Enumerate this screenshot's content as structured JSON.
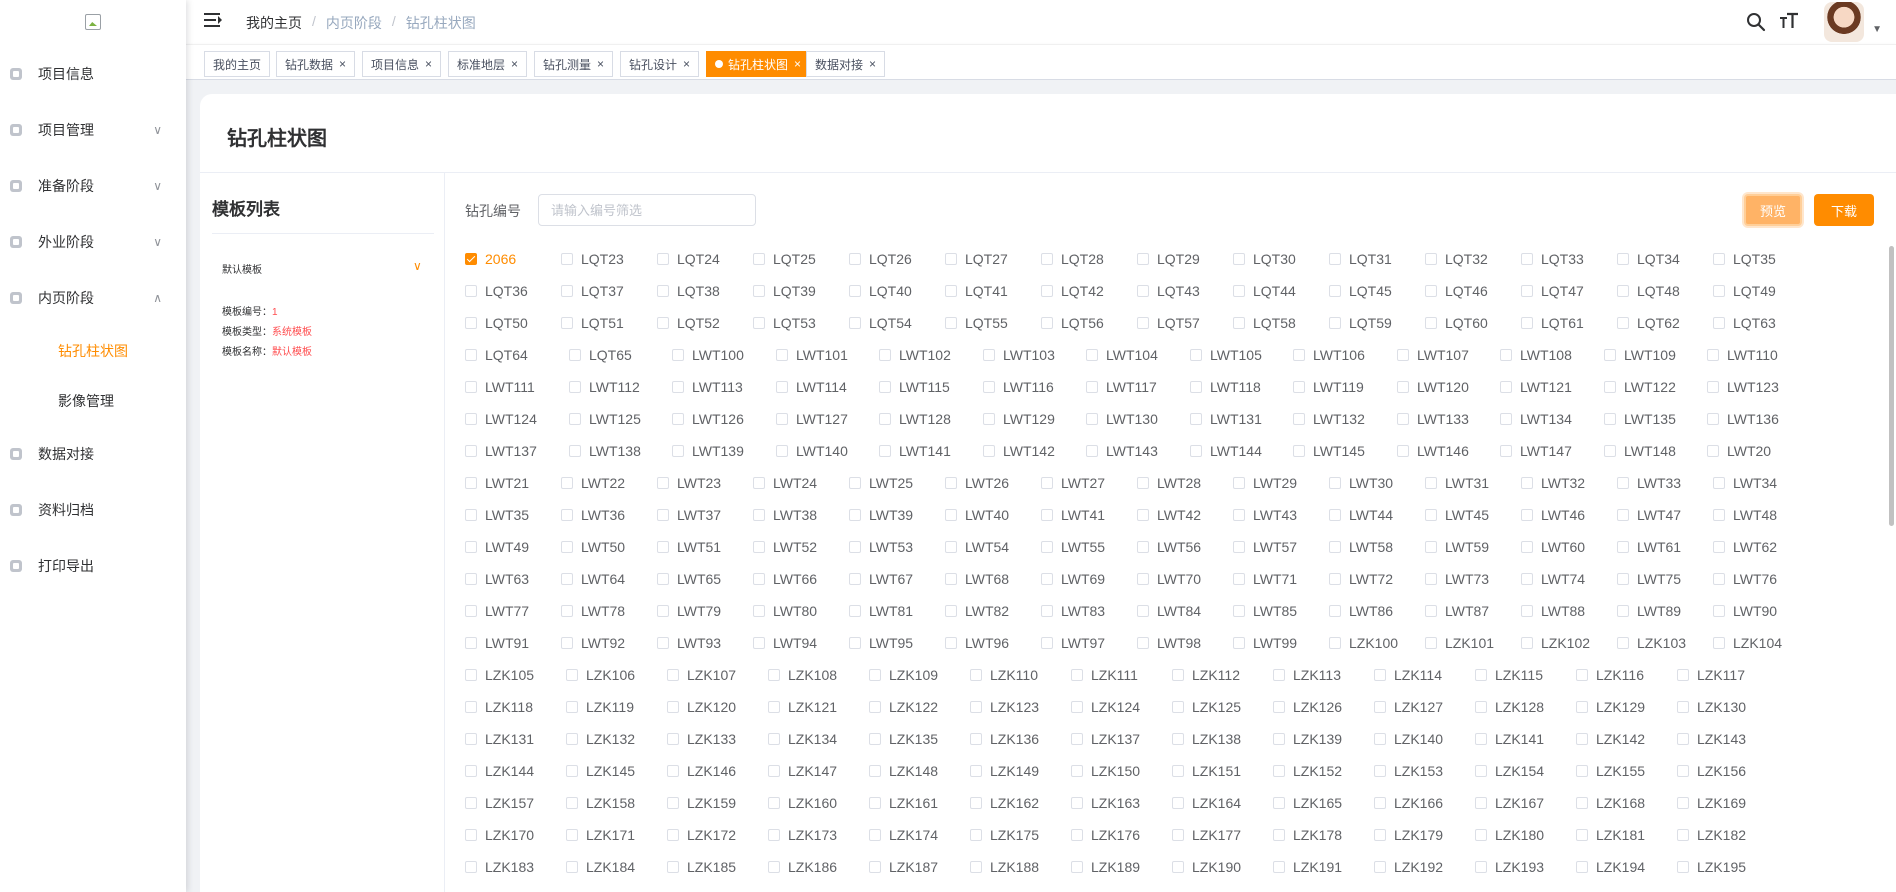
{
  "sidebar": {
    "menu": [
      {
        "label": "项目信息",
        "arrow": ""
      },
      {
        "label": "项目管理",
        "arrow": "∨"
      },
      {
        "label": "准备阶段",
        "arrow": "∨"
      },
      {
        "label": "外业阶段",
        "arrow": "∨"
      },
      {
        "label": "内页阶段",
        "arrow": "∧"
      },
      {
        "label": "数据对接",
        "arrow": ""
      },
      {
        "label": "资料归档",
        "arrow": ""
      },
      {
        "label": "打印导出",
        "arrow": ""
      }
    ],
    "submenu": [
      {
        "label": "钻孔柱状图"
      },
      {
        "label": "影像管理"
      }
    ]
  },
  "header": {
    "breadcrumb": [
      "我的主页",
      "内页阶段",
      "钻孔柱状图"
    ]
  },
  "tags": [
    {
      "label": "我的主页"
    },
    {
      "label": "钻孔数据"
    },
    {
      "label": "项目信息"
    },
    {
      "label": "标准地层"
    },
    {
      "label": "钻孔测量"
    },
    {
      "label": "钻孔设计"
    },
    {
      "label": "钻孔柱状图"
    },
    {
      "label": "数据对接"
    }
  ],
  "page": {
    "title": "钻孔柱状图",
    "template_panel": {
      "title": "模板列表",
      "item_head": "默认模板",
      "meta": [
        {
          "key": "模板编号：",
          "value": "1"
        },
        {
          "key": "模板类型：",
          "value": "系统模板"
        },
        {
          "key": "模板名称：",
          "value": "默认模板"
        }
      ]
    },
    "filter": {
      "label": "钻孔编号",
      "placeholder": "请输入编号筛选"
    },
    "buttons": {
      "preview": "预览",
      "download": "下载"
    },
    "checked_item": "2066"
  },
  "boreholes": [
    [
      "2066",
      "LQT23",
      "LQT24",
      "LQT25",
      "LQT26",
      "LQT27",
      "LQT28",
      "LQT29",
      "LQT30",
      "LQT31",
      "LQT32",
      "LQT33",
      "LQT34",
      "LQT35"
    ],
    [
      "LQT36",
      "LQT37",
      "LQT38",
      "LQT39",
      "LQT40",
      "LQT41",
      "LQT42",
      "LQT43",
      "LQT44",
      "LQT45",
      "LQT46",
      "LQT47",
      "LQT48",
      "LQT49"
    ],
    [
      "LQT50",
      "LQT51",
      "LQT52",
      "LQT53",
      "LQT54",
      "LQT55",
      "LQT56",
      "LQT57",
      "LQT58",
      "LQT59",
      "LQT60",
      "LQT61",
      "LQT62",
      "LQT63"
    ],
    [
      "LQT64",
      "LQT65",
      "LWT100",
      "LWT101",
      "LWT102",
      "LWT103",
      "LWT104",
      "LWT105",
      "LWT106",
      "LWT107",
      "LWT108",
      "LWT109",
      "LWT110"
    ],
    [
      "LWT111",
      "LWT112",
      "LWT113",
      "LWT114",
      "LWT115",
      "LWT116",
      "LWT117",
      "LWT118",
      "LWT119",
      "LWT120",
      "LWT121",
      "LWT122",
      "LWT123"
    ],
    [
      "LWT124",
      "LWT125",
      "LWT126",
      "LWT127",
      "LWT128",
      "LWT129",
      "LWT130",
      "LWT131",
      "LWT132",
      "LWT133",
      "LWT134",
      "LWT135",
      "LWT136"
    ],
    [
      "LWT137",
      "LWT138",
      "LWT139",
      "LWT140",
      "LWT141",
      "LWT142",
      "LWT143",
      "LWT144",
      "LWT145",
      "LWT146",
      "LWT147",
      "LWT148",
      "LWT20"
    ],
    [
      "LWT21",
      "LWT22",
      "LWT23",
      "LWT24",
      "LWT25",
      "LWT26",
      "LWT27",
      "LWT28",
      "LWT29",
      "LWT30",
      "LWT31",
      "LWT32",
      "LWT33",
      "LWT34"
    ],
    [
      "LWT35",
      "LWT36",
      "LWT37",
      "LWT38",
      "LWT39",
      "LWT40",
      "LWT41",
      "LWT42",
      "LWT43",
      "LWT44",
      "LWT45",
      "LWT46",
      "LWT47",
      "LWT48"
    ],
    [
      "LWT49",
      "LWT50",
      "LWT51",
      "LWT52",
      "LWT53",
      "LWT54",
      "LWT55",
      "LWT56",
      "LWT57",
      "LWT58",
      "LWT59",
      "LWT60",
      "LWT61",
      "LWT62"
    ],
    [
      "LWT63",
      "LWT64",
      "LWT65",
      "LWT66",
      "LWT67",
      "LWT68",
      "LWT69",
      "LWT70",
      "LWT71",
      "LWT72",
      "LWT73",
      "LWT74",
      "LWT75",
      "LWT76"
    ],
    [
      "LWT77",
      "LWT78",
      "LWT79",
      "LWT80",
      "LWT81",
      "LWT82",
      "LWT83",
      "LWT84",
      "LWT85",
      "LWT86",
      "LWT87",
      "LWT88",
      "LWT89",
      "LWT90"
    ],
    [
      "LWT91",
      "LWT92",
      "LWT93",
      "LWT94",
      "LWT95",
      "LWT96",
      "LWT97",
      "LWT98",
      "LWT99",
      "LZK100",
      "LZK101",
      "LZK102",
      "LZK103",
      "LZK104"
    ],
    [
      "LZK105",
      "LZK106",
      "LZK107",
      "LZK108",
      "LZK109",
      "LZK110",
      "LZK111",
      "LZK112",
      "LZK113",
      "LZK114",
      "LZK115",
      "LZK116",
      "LZK117"
    ],
    [
      "LZK118",
      "LZK119",
      "LZK120",
      "LZK121",
      "LZK122",
      "LZK123",
      "LZK124",
      "LZK125",
      "LZK126",
      "LZK127",
      "LZK128",
      "LZK129",
      "LZK130"
    ],
    [
      "LZK131",
      "LZK132",
      "LZK133",
      "LZK134",
      "LZK135",
      "LZK136",
      "LZK137",
      "LZK138",
      "LZK139",
      "LZK140",
      "LZK141",
      "LZK142",
      "LZK143"
    ],
    [
      "LZK144",
      "LZK145",
      "LZK146",
      "LZK147",
      "LZK148",
      "LZK149",
      "LZK150",
      "LZK151",
      "LZK152",
      "LZK153",
      "LZK154",
      "LZK155",
      "LZK156"
    ],
    [
      "LZK157",
      "LZK158",
      "LZK159",
      "LZK160",
      "LZK161",
      "LZK162",
      "LZK163",
      "LZK164",
      "LZK165",
      "LZK166",
      "LZK167",
      "LZK168",
      "LZK169"
    ],
    [
      "LZK170",
      "LZK171",
      "LZK172",
      "LZK173",
      "LZK174",
      "LZK175",
      "LZK176",
      "LZK177",
      "LZK178",
      "LZK179",
      "LZK180",
      "LZK181",
      "LZK182"
    ],
    [
      "LZK183",
      "LZK184",
      "LZK185",
      "LZK186",
      "LZK187",
      "LZK188",
      "LZK189",
      "LZK190",
      "LZK191",
      "LZK192",
      "LZK193",
      "LZK194",
      "LZK195"
    ]
  ],
  "colors": {
    "accent": "#ff8c00",
    "text": "#303133",
    "muted": "#606266"
  }
}
